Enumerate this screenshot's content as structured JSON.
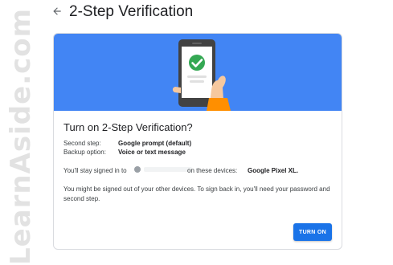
{
  "watermark": {
    "text": "LearnAside.com"
  },
  "header": {
    "title": "2-Step Verification",
    "back_icon": "arrow-left-icon"
  },
  "card": {
    "banner_color": "#4285f4",
    "illustration": "phone-in-hand-checkmark",
    "title": "Turn on 2-Step Verification?",
    "second_step_label": "Second step:",
    "second_step_value": "Google prompt (default)",
    "backup_label": "Backup option:",
    "backup_value": "Voice or text message",
    "signed_in_prefix": "You'll stay signed in to",
    "signed_in_suffix": "on these devices:",
    "device": "Google Pixel XL.",
    "warning": "You might be signed out of your other devices. To sign back in, you'll need your password and second step.",
    "button_label": "TURN ON",
    "button_color": "#1a73e8"
  }
}
